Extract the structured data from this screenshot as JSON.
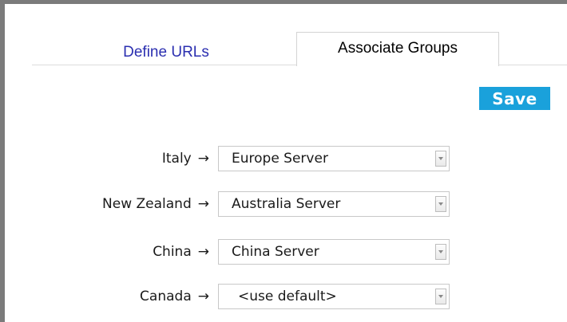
{
  "tabs": [
    {
      "label": "Define URLs",
      "active": false
    },
    {
      "label": "Associate Groups",
      "active": true
    }
  ],
  "toolbar": {
    "save_label": "Save"
  },
  "colors": {
    "save_button": "#1aa1db",
    "inactive_tab_text": "#2b2fb0",
    "frame_border": "#7b7b7b"
  },
  "icons": {
    "arrow": "right-arrow-icon",
    "dropdown": "chevron-down-icon"
  },
  "arrow_glyph": "→",
  "mappings": [
    {
      "country": "Italy",
      "server": "Europe Server"
    },
    {
      "country": "New Zealand",
      "server": "Australia Server"
    },
    {
      "country": "China",
      "server": "China Server"
    },
    {
      "country": "Canada",
      "server": "<use default>"
    }
  ]
}
